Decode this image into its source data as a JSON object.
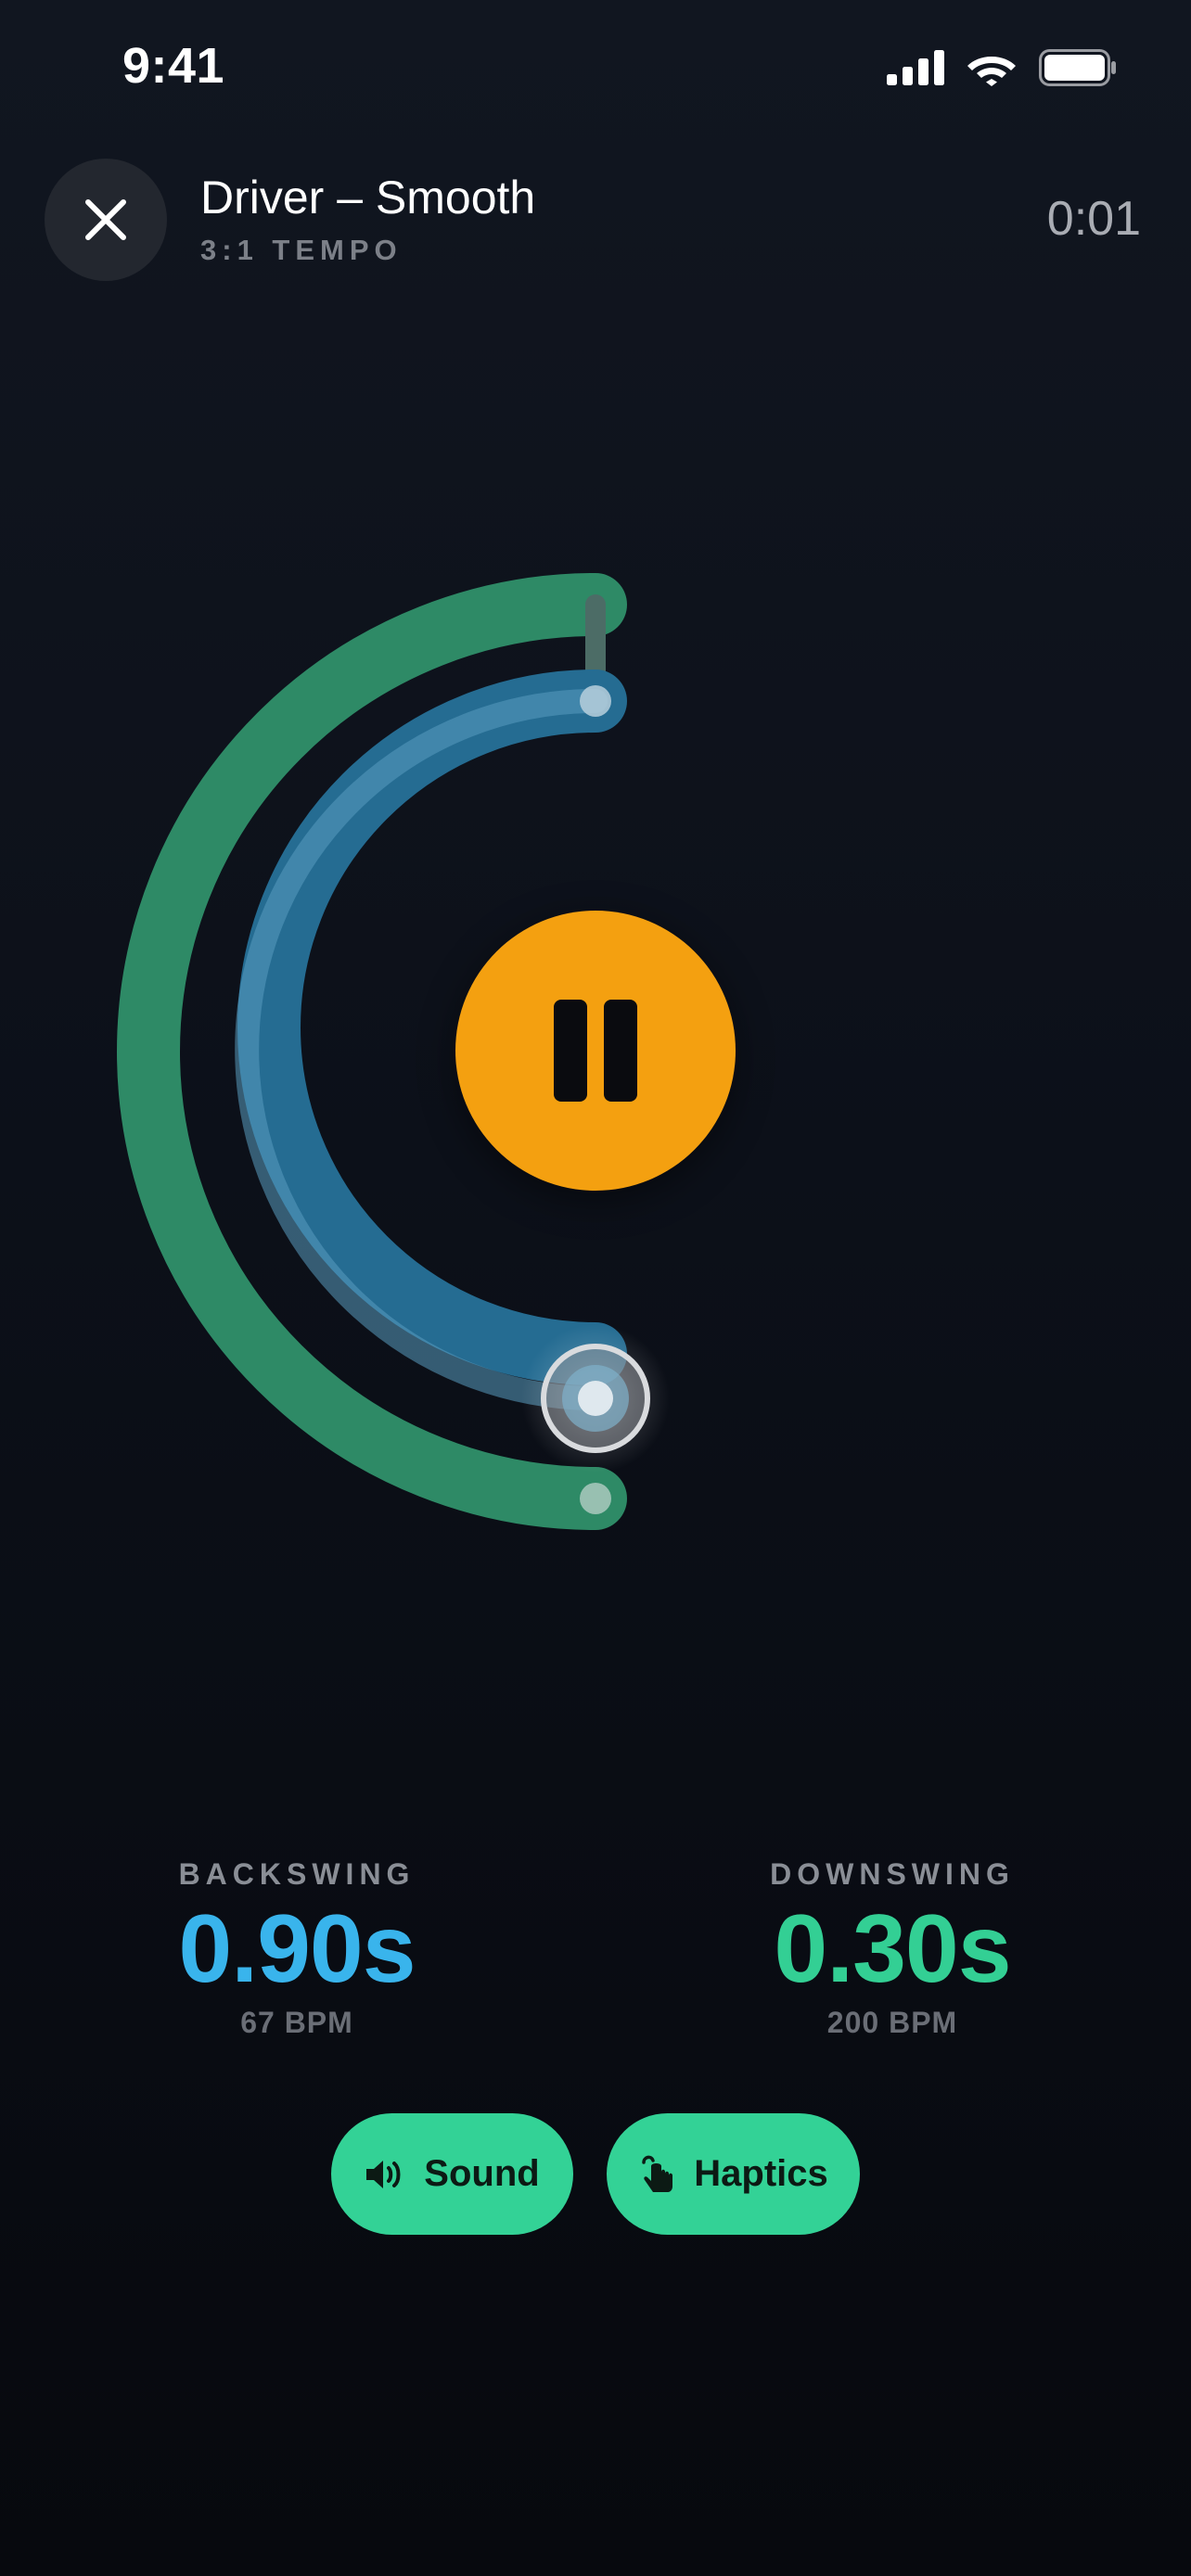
{
  "status_bar": {
    "time": "9:41",
    "icons": [
      "cellular-signal-icon",
      "wifi-icon",
      "battery-icon"
    ]
  },
  "header": {
    "close_icon": "close-icon",
    "title": "Driver – Smooth",
    "subtitle": "3:1 TEMPO",
    "elapsed": "0:01"
  },
  "tempo_visual": {
    "outer_arc_color": "#2e8a66",
    "inner_arc_color": "#256c92",
    "inner_arc_highlight_color": "#5a9cbf",
    "progress_marker": "swing-position-marker"
  },
  "play_control": {
    "state": "playing",
    "icon": "pause-icon",
    "color": "#f4a010"
  },
  "stats": {
    "backswing": {
      "label": "BACKSWING",
      "value": "0.90s",
      "bpm": "67 BPM",
      "color": "#39b4ec"
    },
    "downswing": {
      "label": "DOWNSWING",
      "value": "0.30s",
      "bpm": "200 BPM",
      "color": "#33cf94"
    }
  },
  "toggles": {
    "sound": {
      "label": "Sound",
      "icon": "speaker-icon",
      "enabled": true
    },
    "haptics": {
      "label": "Haptics",
      "icon": "haptic-hand-icon",
      "enabled": true
    },
    "active_color": "#33d296"
  }
}
